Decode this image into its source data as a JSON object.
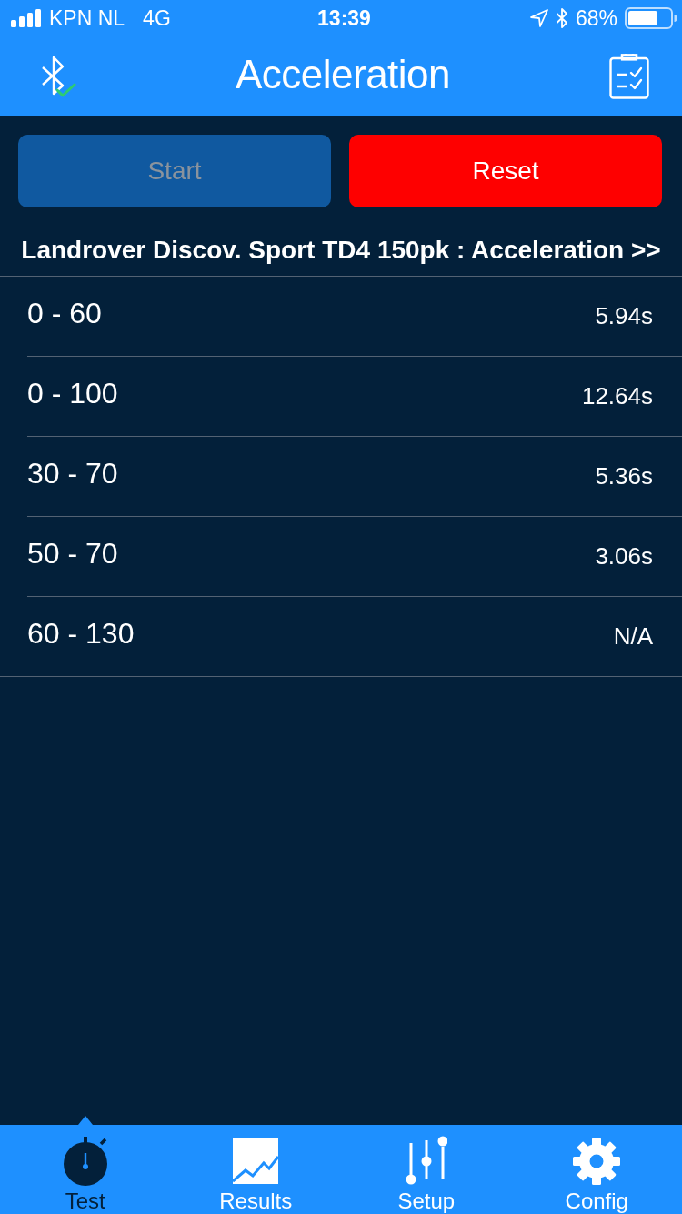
{
  "status_bar": {
    "carrier": "KPN NL",
    "network": "4G",
    "time": "13:39",
    "battery": "68%"
  },
  "nav_bar": {
    "title": "Acceleration"
  },
  "actions": [
    {
      "kind": "start",
      "label": "Start",
      "disabled": true
    },
    {
      "kind": "reset",
      "label": "Reset",
      "disabled": false
    }
  ],
  "header": "Landrover Discov. Sport TD4 150pk : Acceleration >>",
  "results": [
    {
      "range": "0 - 60",
      "time": "5.94s"
    },
    {
      "range": "0 - 100",
      "time": "12.64s"
    },
    {
      "range": "30 - 70",
      "time": "5.36s"
    },
    {
      "range": "50 - 70",
      "time": "3.06s"
    },
    {
      "range": "60 - 130",
      "time": "N/A"
    }
  ],
  "tab_bar": [
    {
      "label": "Test",
      "selected": true
    },
    {
      "label": "Results",
      "selected": false
    },
    {
      "label": "Setup",
      "selected": false
    },
    {
      "label": "Config",
      "selected": false
    }
  ]
}
